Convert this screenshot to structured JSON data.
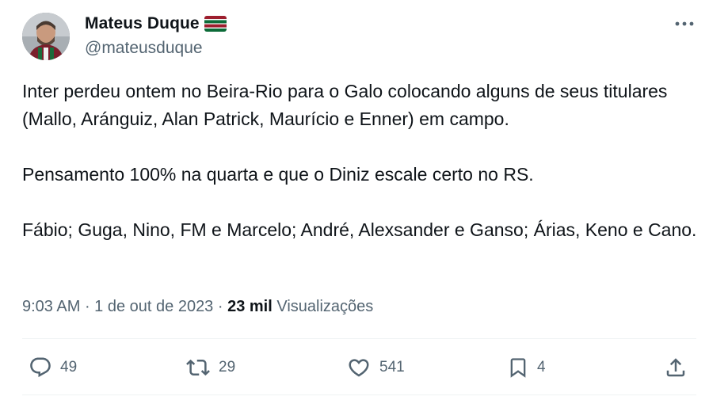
{
  "author": {
    "display_name": "Mateus Duque",
    "handle": "@mateusduque",
    "badge_icon": "fluminense-flag-icon",
    "avatar_icon": "avatar"
  },
  "tweet": {
    "paragraphs": [
      "Inter perdeu ontem no Beira-Rio para o Galo colocando alguns de seus titulares (Mallo, Aránguiz, Alan Patrick, Maurício e Enner) em campo.",
      "Pensamento 100% na quarta e que o Diniz escale certo no RS.",
      "Fábio; Guga, Nino, FM e Marcelo; André, Alexsander e Ganso; Árias, Keno e Cano."
    ],
    "time": "9:03 AM",
    "date": "1 de out de 2023",
    "separator": " · ",
    "views_count": "23 mil",
    "views_label": "Visualizações"
  },
  "actions": {
    "replies": "49",
    "retweets": "29",
    "likes": "541",
    "bookmarks": "4",
    "icons": [
      "reply-icon",
      "retweet-icon",
      "like-icon",
      "bookmark-icon",
      "share-icon"
    ]
  },
  "colors": {
    "text": "#0f1419",
    "secondary": "#536471",
    "divider": "#eff3f4",
    "flag_red": "#9d1e2e",
    "flag_green": "#0c6b38",
    "flag_white": "#ffffff"
  }
}
